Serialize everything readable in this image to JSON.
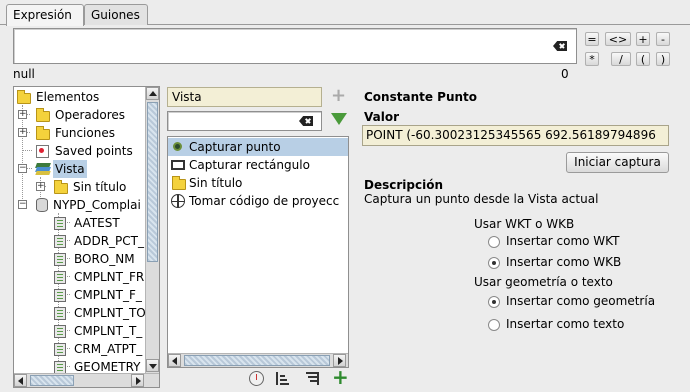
{
  "tabs": [
    {
      "label": "Expresión",
      "active": true
    },
    {
      "label": "Guiones",
      "active": false
    }
  ],
  "expression": {
    "value": ""
  },
  "operators": [
    "=",
    "<>",
    "+",
    "-",
    "*",
    "/",
    "(",
    ")"
  ],
  "result": {
    "value": "null",
    "count": "0"
  },
  "tree": {
    "items": [
      {
        "label": "Elementos",
        "icon": "folder-icon"
      },
      {
        "label": "Operadores",
        "icon": "folder-icon"
      },
      {
        "label": "Funciones",
        "icon": "folder-icon"
      },
      {
        "label": "Saved points",
        "icon": "saved-points-icon"
      },
      {
        "label": "Vista",
        "icon": "layers-icon",
        "selected": true
      },
      {
        "label": "Sin título",
        "icon": "folder-icon"
      },
      {
        "label": "NYPD_Complai",
        "icon": "table-icon"
      },
      {
        "label": "AATEST",
        "icon": "field-icon"
      },
      {
        "label": "ADDR_PCT_",
        "icon": "field-icon"
      },
      {
        "label": "BORO_NM",
        "icon": "field-icon"
      },
      {
        "label": "CMPLNT_FR",
        "icon": "field-icon"
      },
      {
        "label": "CMPLNT_F_",
        "icon": "field-icon"
      },
      {
        "label": "CMPLNT_TO",
        "icon": "field-icon"
      },
      {
        "label": "CMPLNT_T_",
        "icon": "field-icon"
      },
      {
        "label": "CRM_ATPT_",
        "icon": "field-icon"
      },
      {
        "label": "GEOMETRY",
        "icon": "field-icon"
      }
    ]
  },
  "middle": {
    "header": "Vista",
    "filter": {
      "value": ""
    },
    "items": [
      {
        "label": "Capturar punto",
        "icon": "point-icon",
        "selected": true
      },
      {
        "label": "Capturar rectángulo",
        "icon": "rectangle-icon"
      },
      {
        "label": "Sin título",
        "icon": "folder-icon"
      },
      {
        "label": "Tomar código de proyecc",
        "icon": "globe-icon"
      }
    ]
  },
  "detail": {
    "title": "Constante Punto",
    "value_label": "Valor",
    "value": "POINT (-60.30023125345565 692.56189794896",
    "capture_button": "Iniciar captura",
    "description_label": "Descripción",
    "description": "Captura un punto desde la Vista actual",
    "wkt_group_label": "Usar WKT o WKB",
    "wkt_options": [
      {
        "label": "Insertar como WKT",
        "checked": false
      },
      {
        "label": "Insertar como WKB",
        "checked": true
      }
    ],
    "geom_group_label": "Usar geometría o texto",
    "geom_options": [
      {
        "label": "Insertar como geometría",
        "checked": true
      },
      {
        "label": "Insertar como texto",
        "checked": false
      }
    ]
  }
}
